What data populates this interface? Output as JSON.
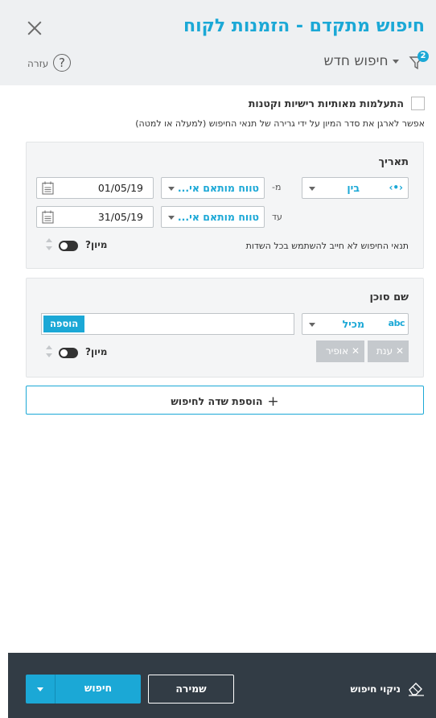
{
  "header": {
    "title": "חיפוש מתקדם - הזמנות לקוח",
    "new_search_label": "חיפוש חדש",
    "filter_badge": "2",
    "help_label": "עזרה",
    "help_icon_glyph": "?"
  },
  "options": {
    "case_insensitive_label": "התעלמות מאותיות רישיות וקטנות",
    "drag_hint": "אפשר לארגן את סדר המיון על ידי גרירה של תנאי החיפוש (למעלה או למטה)"
  },
  "date_panel": {
    "title": "תאריך",
    "operator": "בין",
    "operator_icon": "‹•›",
    "from_label": "מ-",
    "to_label": "עד",
    "from_mode": "טווח מותאם אי...",
    "to_mode": "טווח מותאם אי...",
    "from_value": "01/05/19",
    "to_value": "31/05/19",
    "hint": "תנאי החיפוש לא חייב להשתמש בכל השדות",
    "sort_label": "מיון?"
  },
  "agent_panel": {
    "title": "שם סוכן",
    "operator": "מכיל",
    "abc_icon": "abc",
    "add_button": "הוספה",
    "chips": [
      "ענת",
      "אופיר"
    ],
    "chip_remove": "✕",
    "sort_label": "מיון?"
  },
  "add_field_label": "הוספת שדה לחיפוש",
  "add_field_plus": "+",
  "footer": {
    "search_label": "חיפוש",
    "save_label": "שמירה",
    "clear_label": "ניקוי חיפוש"
  },
  "colors": {
    "accent": "#1ba8d6",
    "footer_bg": "#323c45",
    "header_bg": "#eef0f2"
  }
}
